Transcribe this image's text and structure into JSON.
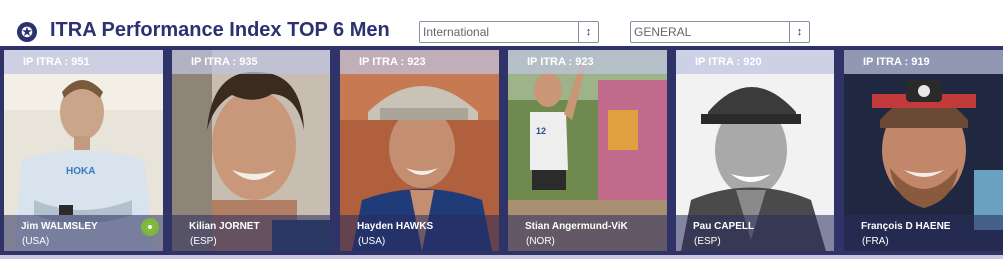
{
  "header": {
    "title": "ITRA Performance Index TOP 6 Men",
    "star_glyph": "✪",
    "select_category": "International",
    "select_ranking": "GENERAL",
    "select_arrows": "↕"
  },
  "colors": {
    "brand_navy": "#2c3170",
    "band": "#2f3368",
    "eye_green": "#7db83a"
  },
  "athletes": [
    {
      "score": "IP ITRA : 951",
      "name": "Jim WALMSLEY",
      "country": "(USA)",
      "has_eye_icon": true
    },
    {
      "score": "IP ITRA : 935",
      "name": "Kilian JORNET",
      "country": "(ESP)"
    },
    {
      "score": "IP ITRA : 923",
      "name": "Hayden HAWKS",
      "country": "(USA)"
    },
    {
      "score": "IP ITRA : 923",
      "name": "Stian Angermund-ViK",
      "country": "(NOR)"
    },
    {
      "score": "IP ITRA : 920",
      "name": "Pau CAPELL",
      "country": "(ESP)"
    },
    {
      "score": "IP ITRA : 919",
      "name": "François D HAENE",
      "country": "(FRA)"
    }
  ]
}
